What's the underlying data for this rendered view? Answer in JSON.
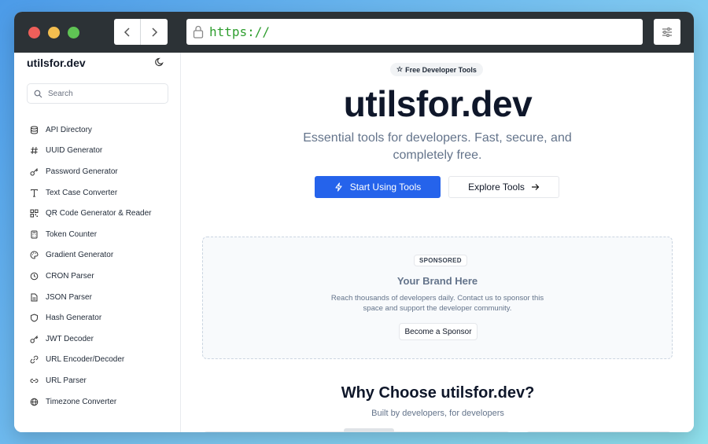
{
  "browser": {
    "url": "https://",
    "icons": {
      "back": "chevron-left-icon",
      "forward": "chevron-right-icon",
      "lock": "lock-icon",
      "settings": "sliders-icon"
    }
  },
  "sidebar": {
    "brand": "utilsfor.dev",
    "theme_icon": "moon-icon",
    "search_placeholder": "Search",
    "items": [
      {
        "label": "API Directory",
        "icon": "database-icon"
      },
      {
        "label": "UUID Generator",
        "icon": "hash-icon"
      },
      {
        "label": "Password Generator",
        "icon": "key-icon"
      },
      {
        "label": "Text Case Converter",
        "icon": "type-icon"
      },
      {
        "label": "QR Code Generator & Reader",
        "icon": "qr-code-icon"
      },
      {
        "label": "Token Counter",
        "icon": "calculator-icon"
      },
      {
        "label": "Gradient Generator",
        "icon": "palette-icon"
      },
      {
        "label": "CRON Parser",
        "icon": "clock-icon"
      },
      {
        "label": "JSON Parser",
        "icon": "file-icon"
      },
      {
        "label": "Hash Generator",
        "icon": "shield-icon"
      },
      {
        "label": "JWT Decoder",
        "icon": "key-icon"
      },
      {
        "label": "URL Encoder/Decoder",
        "icon": "link-icon"
      },
      {
        "label": "URL Parser",
        "icon": "link-icon"
      },
      {
        "label": "Timezone Converter",
        "icon": "globe-icon"
      }
    ]
  },
  "hero": {
    "badge": "Free Developer Tools",
    "title": "utilsfor.dev",
    "subtitle": "Essential tools for developers. Fast, secure, and completely free.",
    "primary_button": "Start Using Tools",
    "secondary_button": "Explore Tools"
  },
  "sponsor": {
    "badge": "SPONSORED",
    "title": "Your Brand Here",
    "text": "Reach thousands of developers daily. Contact us to sponsor this space and support the developer community.",
    "button": "Become a Sponsor"
  },
  "why": {
    "title": "Why Choose utilsfor.dev?",
    "subtitle": "Built by developers, for developers"
  },
  "colors": {
    "accent": "#2563eb",
    "url_text": "#2f9e2f",
    "titlebar": "#2c3236"
  }
}
